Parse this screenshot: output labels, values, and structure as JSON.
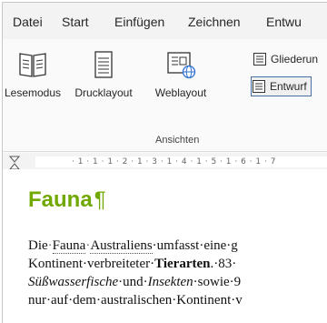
{
  "menu": {
    "tabs": [
      "Datei",
      "Start",
      "Einfügen",
      "Zeichnen",
      "Entwu"
    ]
  },
  "ribbon": {
    "views": {
      "read_mode": "Lesemodus",
      "print_layout": "Drucklayout",
      "web_layout": "Weblayout"
    },
    "small": {
      "outline": "Gliederun",
      "draft": "Entwurf"
    },
    "group_label": "Ansichten"
  },
  "ruler": {
    "text": "· 1 · 1 · 1 · 2 · 1 · 3 · 1 · 4 · 1 · 5 · 1 · 6 · 1 · 7"
  },
  "document": {
    "heading": "Fauna",
    "pilcrow": "¶",
    "lines": [
      {
        "parts": [
          {
            "t": "Die",
            "s": ""
          },
          {
            "t": "·",
            "s": "dot"
          },
          {
            "t": "Fauna",
            "s": "u"
          },
          {
            "t": "·",
            "s": "dot"
          },
          {
            "t": "Australiens",
            "s": "u"
          },
          {
            "t": "·umfasst·eine·g",
            "s": ""
          }
        ]
      },
      {
        "parts": [
          {
            "t": "Kontinent·verbreiteter·",
            "s": ""
          },
          {
            "t": "Tierarten",
            "s": "b"
          },
          {
            "t": ".·83·",
            "s": ""
          }
        ]
      },
      {
        "parts": [
          {
            "t": "Süßwasserfische",
            "s": "i"
          },
          {
            "t": "·und·",
            "s": ""
          },
          {
            "t": "Insekten",
            "s": "i"
          },
          {
            "t": "·sowie·9",
            "s": ""
          }
        ]
      },
      {
        "parts": [
          {
            "t": "nur·auf·dem·australischen·Kontinent·v",
            "s": ""
          }
        ]
      }
    ]
  }
}
